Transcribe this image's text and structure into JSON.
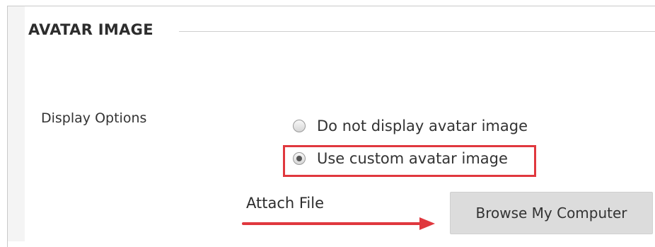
{
  "section": {
    "title": "AVATAR IMAGE"
  },
  "display_options": {
    "label": "Display Options",
    "options": [
      {
        "label": "Do not display avatar image",
        "selected": false
      },
      {
        "label": "Use custom avatar image",
        "selected": true
      }
    ]
  },
  "attach": {
    "annotation_label": "Attach File",
    "browse_button_label": "Browse My Computer"
  },
  "colors": {
    "highlight": "#e0383e",
    "button_bg": "#dcdcdc",
    "text": "#333333"
  }
}
